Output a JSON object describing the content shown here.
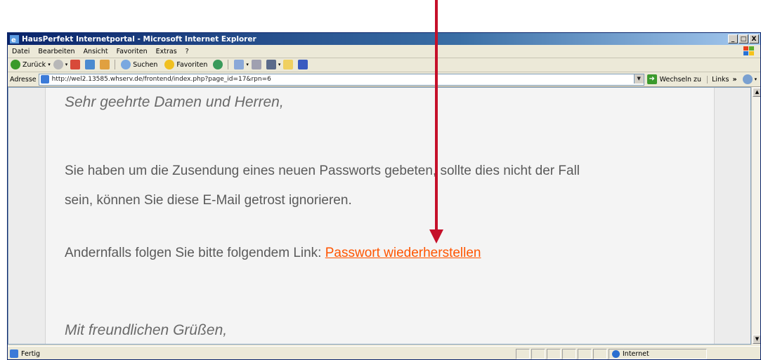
{
  "window": {
    "title": "HausPerfekt Internetportal - Microsoft Internet Explorer",
    "buttons": {
      "minimize": "_",
      "maximize": "□",
      "close": "X"
    }
  },
  "menu": [
    "Datei",
    "Bearbeiten",
    "Ansicht",
    "Favoriten",
    "Extras",
    "?"
  ],
  "toolbar": {
    "back_label": "Zurück",
    "search_label": "Suchen",
    "favorites_label": "Favoriten"
  },
  "address": {
    "label": "Adresse",
    "url": "http://wel2.13585.whserv.de/frontend/index.php?page_id=17&rpn=6",
    "go_label": "Wechseln zu",
    "links_label": "Links",
    "chevron": "»"
  },
  "email": {
    "greeting": "Sehr geehrte Damen und Herren,",
    "paragraph_line1": "Sie haben um die Zusendung eines neuen Passworts gebeten, sollte dies nicht der Fall",
    "paragraph_line2": "sein, können Sie diese E-Mail getrost ignorieren.",
    "link_intro": "Andernfalls folgen Sie bitte folgendem Link:",
    "link_text": "Passwort wiederherstellen",
    "closing": "Mit freundlichen Grüßen,"
  },
  "status": {
    "text": "Fertig",
    "zone": "Internet"
  },
  "colors": {
    "title_bar": "#0a246a",
    "link": "#ff5500",
    "annotation_arrow": "#c5102a"
  }
}
